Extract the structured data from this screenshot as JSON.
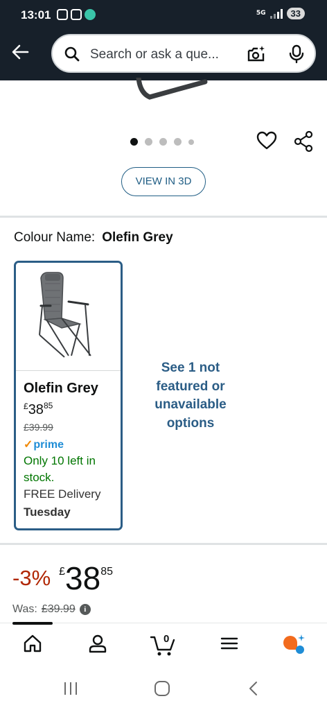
{
  "status_bar": {
    "time": "13:01",
    "network": "5G",
    "battery": "33"
  },
  "header": {
    "search_placeholder": "Search or ask a que..."
  },
  "gallery": {
    "image_count": 5,
    "active_index": 0,
    "view_3d_label": "VIEW IN 3D"
  },
  "colour": {
    "label": "Colour Name:",
    "selected": "Olefin Grey"
  },
  "swatch": {
    "name": "Olefin Grey",
    "currency": "£",
    "price_whole": "38",
    "price_fraction": "85",
    "was_price": "£39.99",
    "prime_label": "prime",
    "stock": "Only 10 left in stock.",
    "delivery": "FREE Delivery",
    "delivery_day": "Tuesday"
  },
  "more_options": "See 1 not featured or unavailable options",
  "price": {
    "discount": "-3%",
    "currency": "£",
    "whole": "38",
    "fraction": "85",
    "was_label": "Was:",
    "was_price": "£39.99"
  },
  "bottom_nav": {
    "cart_count": "0",
    "items": [
      "home",
      "account",
      "cart",
      "menu",
      "rufus"
    ]
  },
  "colors": {
    "header_bg": "#17202a",
    "link_blue": "#2b5d86",
    "discount_red": "#b12704",
    "stock_green": "#007600",
    "prime_blue": "#1f8dd6"
  }
}
